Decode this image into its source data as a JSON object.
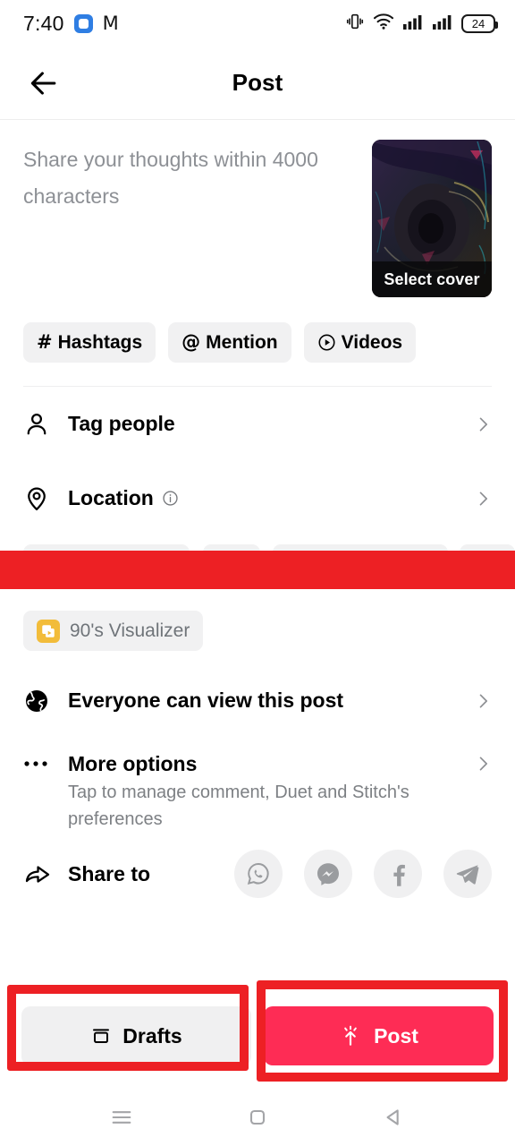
{
  "status_bar": {
    "time": "7:40",
    "left_icons": [
      "app-square-icon",
      "gmail-icon"
    ],
    "right_icons": [
      "vibrate-icon",
      "wifi-icon",
      "signal-1-icon",
      "signal-2-icon"
    ],
    "battery_level": "24"
  },
  "header": {
    "back_icon": "arrow-left-icon",
    "title": "Post"
  },
  "compose": {
    "placeholder": "Share your thoughts within 4000 characters",
    "cover": {
      "label": "Select cover"
    }
  },
  "chips": [
    {
      "glyph": "#",
      "label": "Hashtags",
      "icon": "hashtag-icon"
    },
    {
      "glyph": "@",
      "label": "Mention",
      "icon": "mention-icon"
    },
    {
      "glyph": "▶",
      "label": "Videos",
      "icon": "play-circle-icon"
    }
  ],
  "rows": {
    "tag_people": {
      "label": "Tag people",
      "icon": "person-icon",
      "chevron": "chevron-right-icon"
    },
    "location": {
      "label": "Location",
      "icon": "location-pin-icon",
      "info_icon": "info-icon",
      "chevron": "chevron-right-icon"
    },
    "visibility": {
      "label": "Everyone can view this post",
      "icon": "globe-icon",
      "chevron": "chevron-right-icon"
    },
    "more_options": {
      "label": "More options",
      "subtitle": "Tap to manage comment, Duet and Stitch's preferences",
      "icon": "ellipsis-icon",
      "chevron": "chevron-right-icon"
    },
    "share_to": {
      "label": "Share to",
      "icon": "share-arrow-icon"
    }
  },
  "effect_chip": {
    "label": "90's Visualizer",
    "icon": "effect-card-icon"
  },
  "socials": [
    {
      "name": "whatsapp-icon"
    },
    {
      "name": "messenger-icon"
    },
    {
      "name": "facebook-icon"
    },
    {
      "name": "telegram-icon"
    }
  ],
  "actions": {
    "drafts": {
      "label": "Drafts",
      "icon": "drafts-box-icon"
    },
    "post": {
      "label": "Post",
      "icon": "upload-sparkle-icon"
    }
  },
  "navbar": {
    "recents": "menu-lines-icon",
    "home": "home-square-icon",
    "back": "back-triangle-icon"
  },
  "colors": {
    "accent": "#fe2c55",
    "annotation": "#ed2024",
    "chip_bg": "#f1f1f2",
    "muted_text": "#8d9095"
  }
}
